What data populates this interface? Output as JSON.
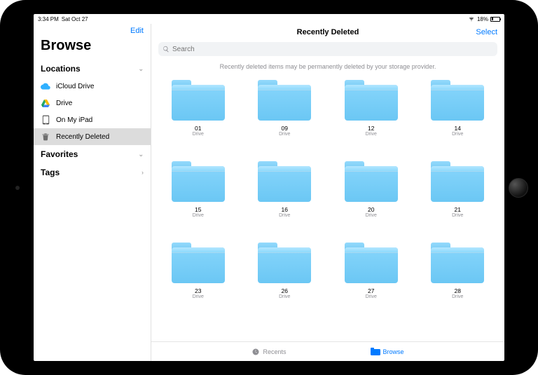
{
  "statusbar": {
    "time": "3:34 PM",
    "date": "Sat Oct 27",
    "battery_pct": "18%"
  },
  "sidebar": {
    "edit_label": "Edit",
    "title": "Browse",
    "sections": {
      "locations_label": "Locations",
      "favorites_label": "Favorites",
      "tags_label": "Tags"
    },
    "locations": [
      {
        "label": "iCloud Drive",
        "icon": "cloud-icon"
      },
      {
        "label": "Drive",
        "icon": "gdrive-icon"
      },
      {
        "label": "On My iPad",
        "icon": "ipad-icon"
      },
      {
        "label": "Recently Deleted",
        "icon": "trash-icon"
      }
    ]
  },
  "content": {
    "title": "Recently Deleted",
    "select_label": "Select",
    "search_placeholder": "Search",
    "note": "Recently deleted items may be permanently deleted by your storage provider."
  },
  "folders": [
    {
      "name": "01",
      "sub": "Drive"
    },
    {
      "name": "09",
      "sub": "Drive"
    },
    {
      "name": "12",
      "sub": "Drive"
    },
    {
      "name": "14",
      "sub": "Drive"
    },
    {
      "name": "15",
      "sub": "Drive"
    },
    {
      "name": "16",
      "sub": "Drive"
    },
    {
      "name": "20",
      "sub": "Drive"
    },
    {
      "name": "21",
      "sub": "Drive"
    },
    {
      "name": "23",
      "sub": "Drive"
    },
    {
      "name": "26",
      "sub": "Drive"
    },
    {
      "name": "27",
      "sub": "Drive"
    },
    {
      "name": "28",
      "sub": "Drive"
    }
  ],
  "tabbar": {
    "recents": "Recents",
    "browse": "Browse"
  }
}
